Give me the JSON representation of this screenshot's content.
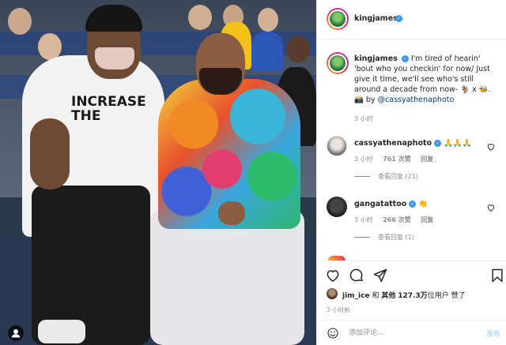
{
  "post": {
    "username": "kingjames",
    "caption": "I'm tired of hearin' 'bout who you checkin' for now/ Just give it time, we'll see who's still around a decade from now-",
    "caption_emojis": "🐐 x 🐝. 📸 by",
    "caption_mention": "@cassyathenaphoto",
    "caption_time": "3 小时"
  },
  "comments": [
    {
      "username": "cassyathenaphoto",
      "text": "🙏🙏🙏",
      "time": "3 小时",
      "likes": "761 次赞",
      "reply": "回复",
      "view_replies": "查看回复 (21)"
    },
    {
      "username": "gangatattoo",
      "text": "👏",
      "time": "3 小时",
      "likes": "266 次赞",
      "reply": "回复",
      "view_replies": "查看回复 (1)"
    }
  ],
  "likes": {
    "first_user": "jim_ice",
    "connector": "和",
    "others_label": "其他",
    "count": "127.3万",
    "suffix": "位用户 赞了"
  },
  "post_time": "3 小时前",
  "comment_box": {
    "placeholder": "添加评论...",
    "post_label": "发布"
  },
  "photo": {
    "shirt_text": "INCREASE THE"
  },
  "icons": {
    "like": "heart-icon",
    "comment": "comment-icon",
    "share": "share-icon",
    "save": "bookmark-icon",
    "emoji": "emoji-icon"
  },
  "colors": {
    "verified": "#3897f0",
    "mention": "#00376b",
    "muted": "#8e8e8e",
    "post_button": "#b3dbff"
  }
}
